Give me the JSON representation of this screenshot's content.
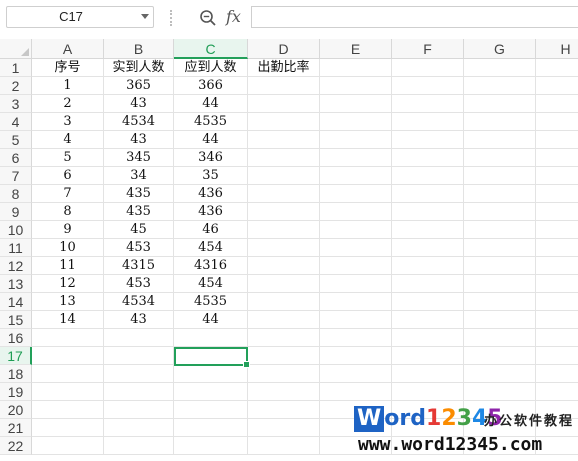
{
  "formula_bar": {
    "cell_ref": "C17",
    "fx_label": "fx",
    "formula": ""
  },
  "columns": [
    "A",
    "B",
    "C",
    "D",
    "E",
    "F",
    "G",
    "H"
  ],
  "active_column": "C",
  "rows": [
    "1",
    "2",
    "3",
    "4",
    "5",
    "6",
    "7",
    "8",
    "9",
    "10",
    "11",
    "12",
    "13",
    "14",
    "15",
    "16",
    "17",
    "18",
    "19",
    "20",
    "21",
    "22"
  ],
  "active_row": "17",
  "headers": {
    "a": "序号",
    "b": "实到人数",
    "c": "应到人数",
    "d": "出勤比率"
  },
  "table_rows": [
    {
      "a": "1",
      "b": "365",
      "c": "366"
    },
    {
      "a": "2",
      "b": "43",
      "c": "44"
    },
    {
      "a": "3",
      "b": "4534",
      "c": "4535"
    },
    {
      "a": "4",
      "b": "43",
      "c": "44"
    },
    {
      "a": "5",
      "b": "345",
      "c": "346"
    },
    {
      "a": "6",
      "b": "34",
      "c": "35"
    },
    {
      "a": "7",
      "b": "435",
      "c": "436"
    },
    {
      "a": "8",
      "b": "435",
      "c": "436"
    },
    {
      "a": "9",
      "b": "45",
      "c": "46"
    },
    {
      "a": "10",
      "b": "453",
      "c": "454"
    },
    {
      "a": "11",
      "b": "4315",
      "c": "4316"
    },
    {
      "a": "12",
      "b": "453",
      "c": "454"
    },
    {
      "a": "13",
      "b": "4534",
      "c": "4535"
    },
    {
      "a": "14",
      "b": "43",
      "c": "44"
    }
  ],
  "watermark": {
    "logo_w": "W",
    "logo_rest": "ord12345",
    "tagline": "办公软件教程",
    "url": "www.word12345.com",
    "colors": {
      "w_bg": "#1e63c4",
      "digits": [
        "#e53935",
        "#fb8c00",
        "#43a047",
        "#1e88e5",
        "#8e24aa"
      ]
    }
  },
  "colors": {
    "accent": "#22a05a",
    "header_bg": "#f7f7f7",
    "gridline": "#e3e3e3"
  }
}
